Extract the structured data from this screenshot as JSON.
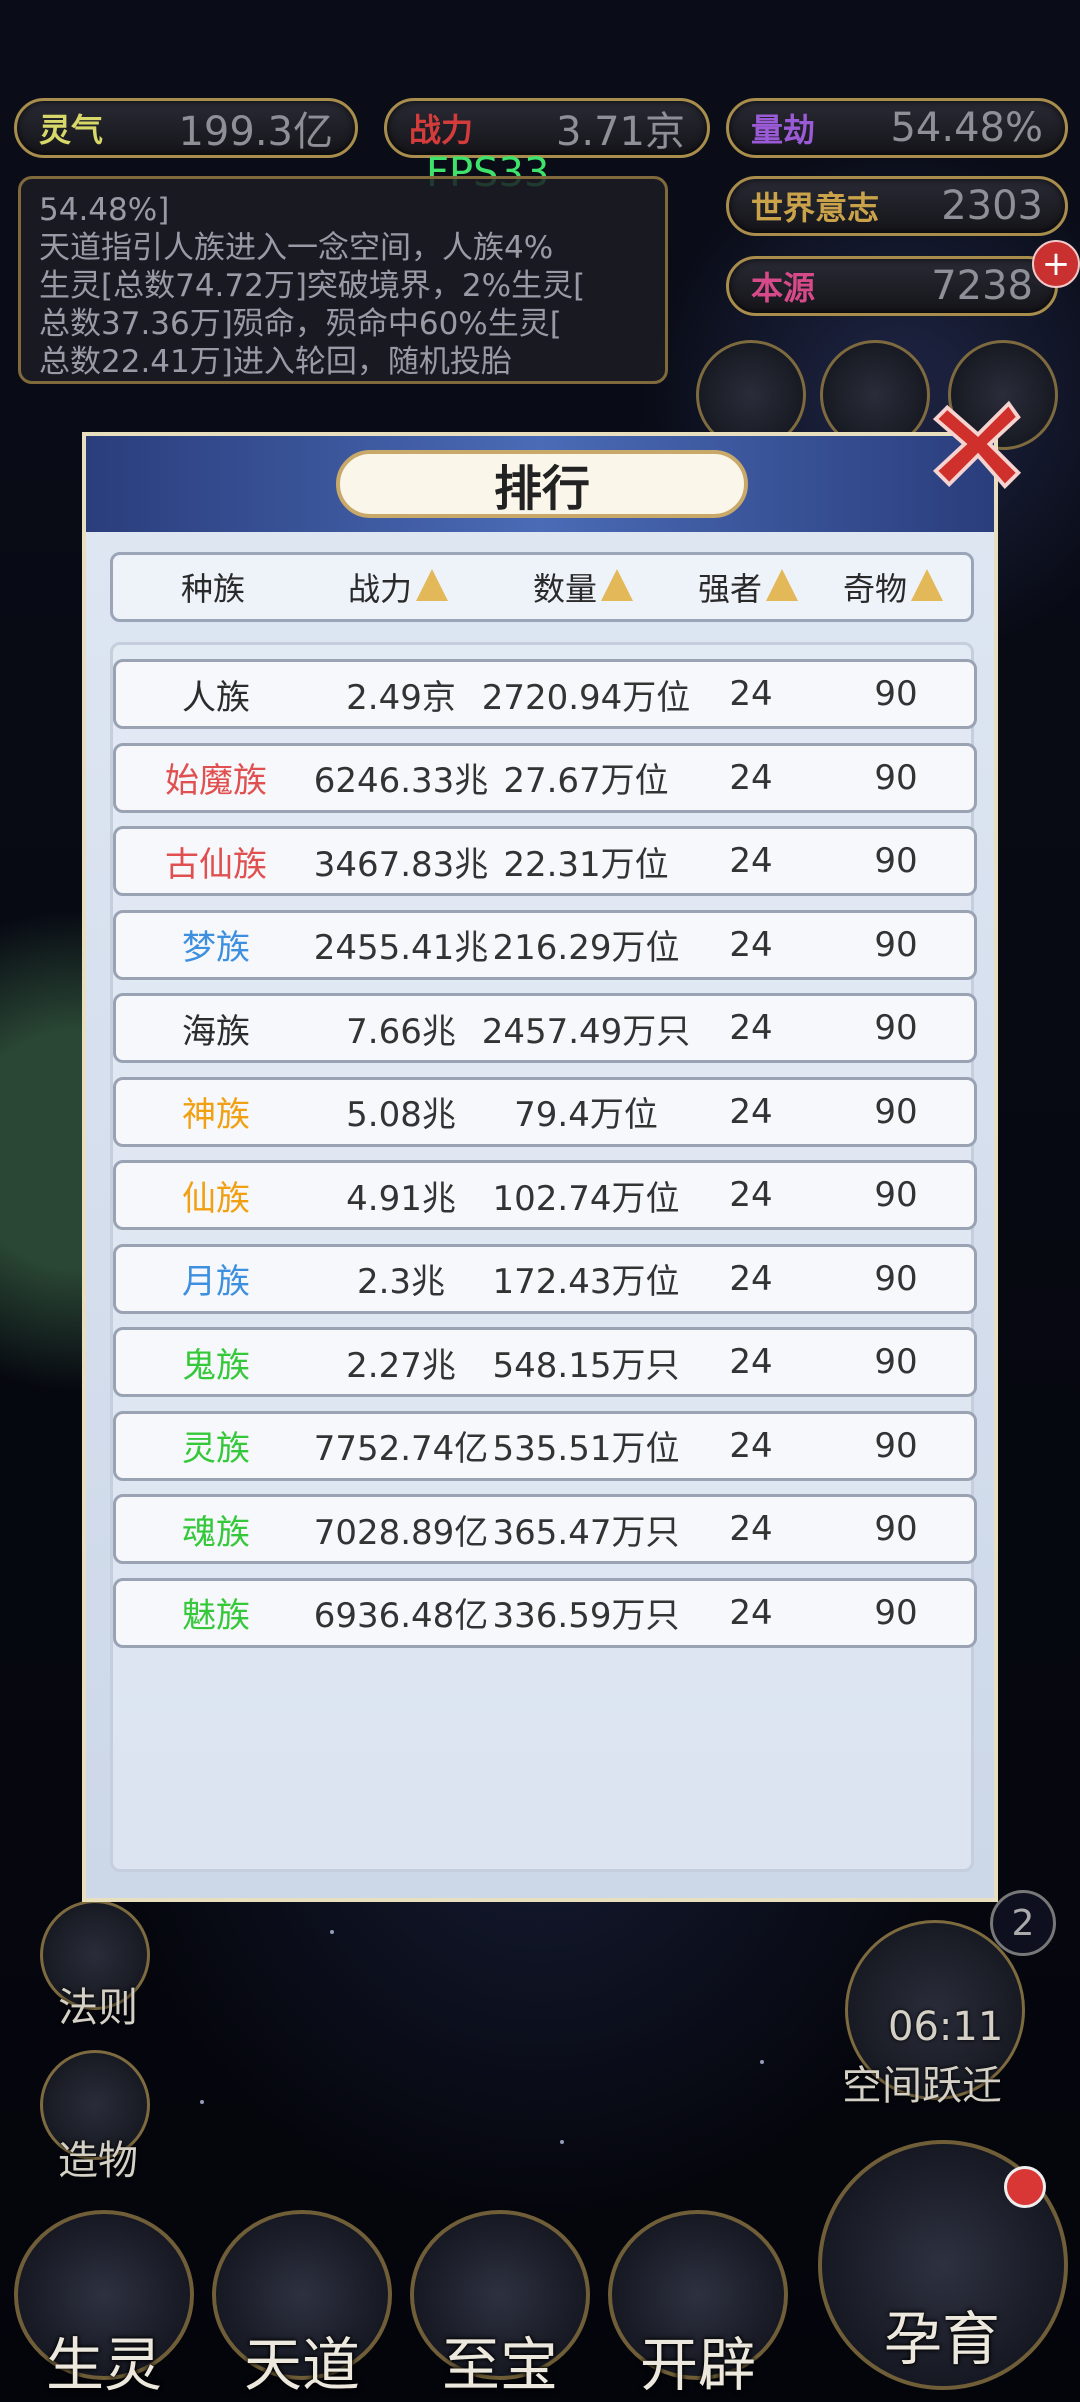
{
  "stats": {
    "lingqi": {
      "label": "灵气",
      "value": "199.3亿",
      "color": "#d8d86a"
    },
    "zhanli": {
      "label": "战力",
      "value": "3.71京",
      "color": "#d43c3c"
    },
    "liangjie": {
      "label": "量劫",
      "value": "54.48%",
      "color": "#9b5bd6"
    },
    "world_will": {
      "label": "世界意志",
      "value": "2303",
      "color": "#c9a24a"
    },
    "origin": {
      "label": "本源",
      "value": "7238",
      "color": "#d64a8a"
    }
  },
  "fps": "FPS33",
  "log": {
    "lines": [
      "54.48%]",
      "天道指引人族进入一念空间，人族4%",
      "生灵[总数74.72万]突破境界，2%生灵[",
      "总数37.36万]殒命，殒命中60%生灵[",
      "总数22.41万]进入轮回，随机投胎"
    ]
  },
  "left_menu": {
    "fa_ze": "法则",
    "zao_wu": "造物"
  },
  "right_menu": {
    "timer": "06:11",
    "space_jump": "空间跃迁",
    "badge_count": "2"
  },
  "bottom_nav": {
    "sheng_ling": "生灵",
    "tian_dao": "天道",
    "zhi_bao": "至宝",
    "kai_pi": "开辟",
    "yun_yu": "孕育"
  },
  "dialog": {
    "title": "排行",
    "columns": {
      "race": "种族",
      "power": "战力",
      "count": "数量",
      "strong": "强者",
      "treasure": "奇物"
    },
    "rows": [
      {
        "race": "人族",
        "power": "2.49京",
        "count": "2720.94万位",
        "strong": "24",
        "treasure": "90",
        "color": "#2c2c2c"
      },
      {
        "race": "始魔族",
        "power": "6246.33兆",
        "count": "27.67万位",
        "strong": "24",
        "treasure": "90",
        "color": "#e05050"
      },
      {
        "race": "古仙族",
        "power": "3467.83兆",
        "count": "22.31万位",
        "strong": "24",
        "treasure": "90",
        "color": "#e05050"
      },
      {
        "race": "梦族",
        "power": "2455.41兆",
        "count": "216.29万位",
        "strong": "24",
        "treasure": "90",
        "color": "#3d8fe0"
      },
      {
        "race": "海族",
        "power": "7.66兆",
        "count": "2457.49万只",
        "strong": "24",
        "treasure": "90",
        "color": "#2c2c2c"
      },
      {
        "race": "神族",
        "power": "5.08兆",
        "count": "79.4万位",
        "strong": "24",
        "treasure": "90",
        "color": "#f0a012"
      },
      {
        "race": "仙族",
        "power": "4.91兆",
        "count": "102.74万位",
        "strong": "24",
        "treasure": "90",
        "color": "#f0a012"
      },
      {
        "race": "月族",
        "power": "2.3兆",
        "count": "172.43万位",
        "strong": "24",
        "treasure": "90",
        "color": "#3d8fe0"
      },
      {
        "race": "鬼族",
        "power": "2.27兆",
        "count": "548.15万只",
        "strong": "24",
        "treasure": "90",
        "color": "#35c83a"
      },
      {
        "race": "灵族",
        "power": "7752.74亿",
        "count": "535.51万位",
        "strong": "24",
        "treasure": "90",
        "color": "#35c83a"
      },
      {
        "race": "魂族",
        "power": "7028.89亿",
        "count": "365.47万只",
        "strong": "24",
        "treasure": "90",
        "color": "#35c83a"
      },
      {
        "race": "魅族",
        "power": "6936.48亿",
        "count": "336.59万只",
        "strong": "24",
        "treasure": "90",
        "color": "#35c83a"
      }
    ]
  }
}
